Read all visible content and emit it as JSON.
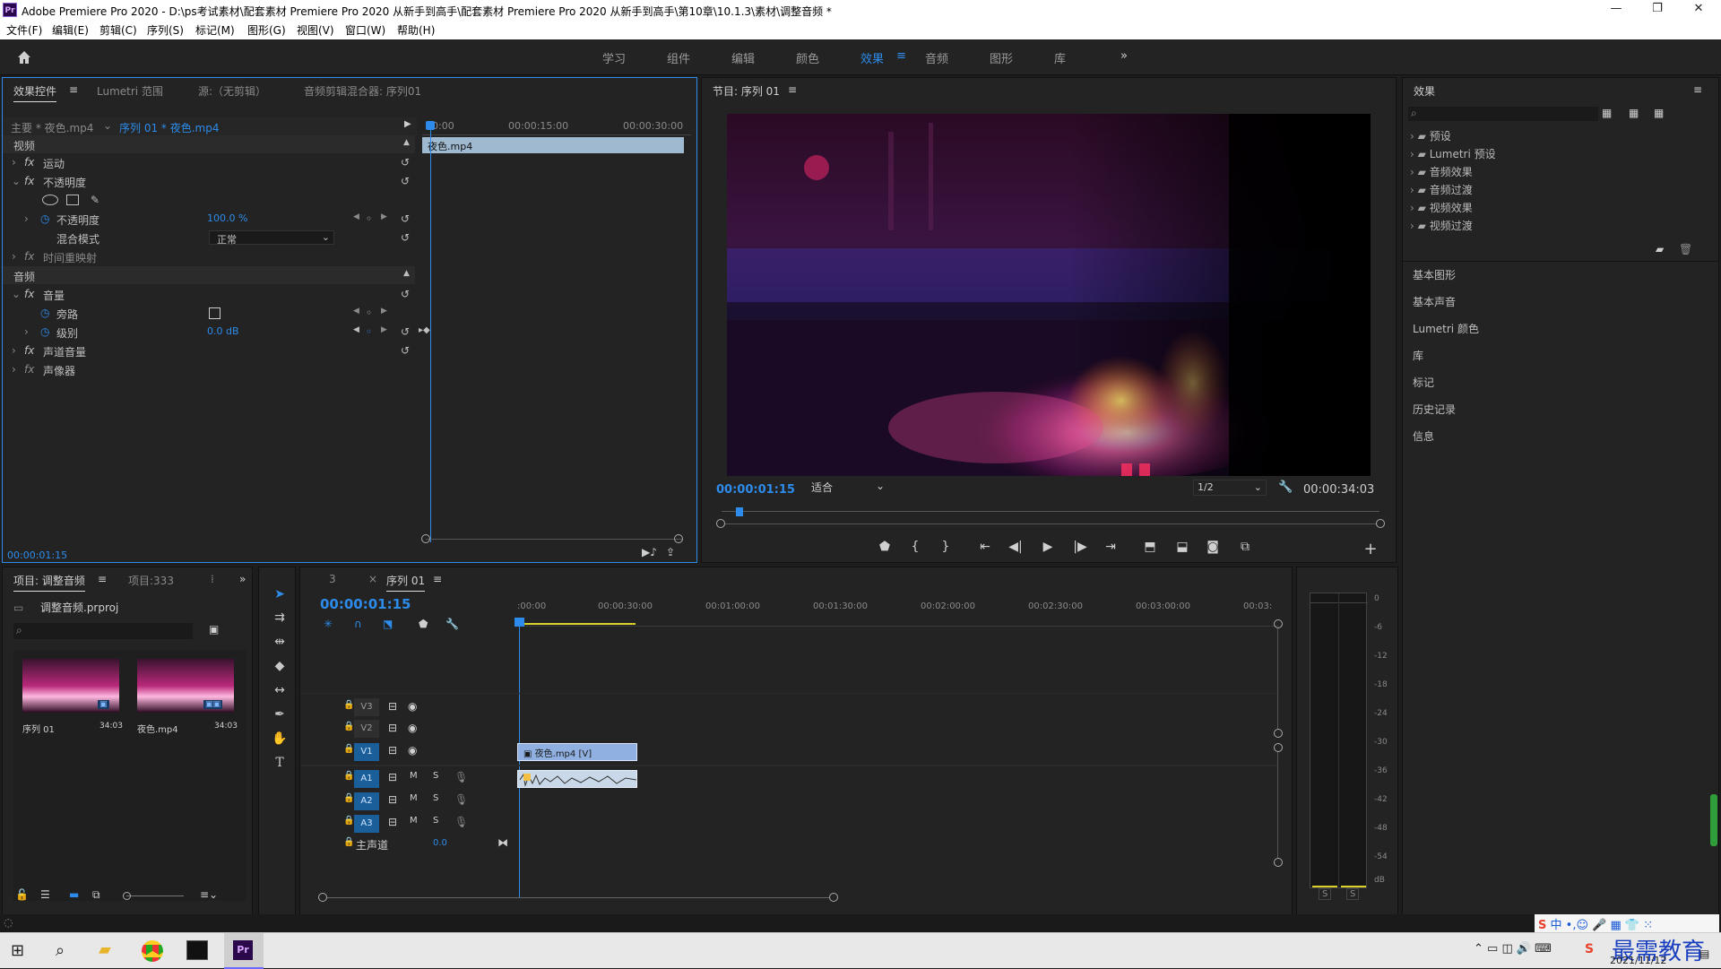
{
  "app": {
    "icon_label": "Pr",
    "title": "Adobe Premiere Pro 2020 - D:\\ps考试素材\\配套素材 Premiere Pro 2020 从新手到高手\\配套素材 Premiere Pro 2020 从新手到高手\\第10章\\10.1.3\\素材\\调整音频 *",
    "window_controls": [
      "—",
      "❐",
      "✕"
    ]
  },
  "menu": [
    "文件(F)",
    "编辑(E)",
    "剪辑(C)",
    "序列(S)",
    "标记(M)",
    "图形(G)",
    "视图(V)",
    "窗口(W)",
    "帮助(H)"
  ],
  "workspaces": {
    "tabs": [
      "学习",
      "组件",
      "编辑",
      "颜色",
      "效果",
      "音频",
      "图形",
      "库"
    ],
    "active": "效果",
    "more": "»"
  },
  "effect_controls": {
    "tabs": [
      "效果控件",
      "Lumetri 范围",
      "源:（无剪辑）",
      "音频剪辑混合器: 序列01"
    ],
    "master": "主要 * 夜色.mp4",
    "sequence": "序列 01 * 夜色.mp4",
    "ruler": [
      "00:00",
      "00:00:15:00",
      "00:00:30:00"
    ],
    "clip_name": "夜色.mp4",
    "video_header": "视频",
    "motion": "运动",
    "opacity_group": "不透明度",
    "opacity_label": "不透明度",
    "opacity_value": "100.0 %",
    "blend_label": "混合模式",
    "blend_value": "正常",
    "time_remap": "时间重映射",
    "audio_header": "音频",
    "volume": "音量",
    "bypass": "旁路",
    "level_label": "级别",
    "level_value": "0.0 dB",
    "channel_volume": "声道音量",
    "panner": "声像器",
    "timecode": "00:00:01:15"
  },
  "program": {
    "title": "节目: 序列 01",
    "timecode": "00:00:01:15",
    "fit": "适合",
    "resolution": "1/2",
    "duration": "00:00:34:03"
  },
  "effects_panel": {
    "title": "效果",
    "tree": [
      "预设",
      "Lumetri 预设",
      "音频效果",
      "音频过渡",
      "视频效果",
      "视频过渡"
    ],
    "sections": [
      "基本图形",
      "基本声音",
      "Lumetri 颜色",
      "库",
      "标记",
      "历史记录",
      "信息"
    ]
  },
  "project": {
    "tabs": [
      "项目: 调整音频",
      "项目:333"
    ],
    "file": "调整音频.prproj",
    "items": [
      {
        "name": "序列 01",
        "duration": "34:03"
      },
      {
        "name": "夜色.mp4",
        "duration": "34:03"
      }
    ]
  },
  "timeline": {
    "tabs": [
      "3",
      "序列 01"
    ],
    "timecode": "00:00:01:15",
    "ruler": [
      ":00:00",
      "00:00:30:00",
      "00:01:00:00",
      "00:01:30:00",
      "00:02:00:00",
      "00:02:30:00",
      "00:03:00:00",
      "00:03:"
    ],
    "video_tracks": [
      "V3",
      "V2",
      "V1"
    ],
    "audio_tracks": [
      "A1",
      "A2",
      "A3"
    ],
    "master": "主声道",
    "master_value": "0.0",
    "video_clip": "夜色.mp4 [V]"
  },
  "meter": {
    "scale": [
      "0",
      "-6",
      "-12",
      "-18",
      "-24",
      "-30",
      "-36",
      "-42",
      "-48",
      "-54",
      "dB"
    ],
    "solo": [
      "S",
      "S"
    ]
  },
  "taskbar": {
    "date": "2021/11/12",
    "watermark": "最需教育",
    "ime": "中"
  }
}
